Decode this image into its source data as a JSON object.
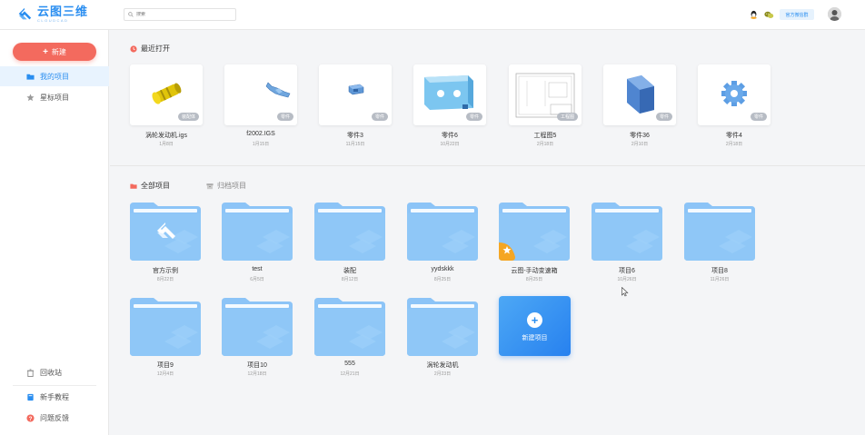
{
  "app": {
    "logo_cn": "云图三维",
    "logo_en": "CLOUDCAD"
  },
  "header": {
    "search_placeholder": "搜索",
    "wechat_label": "官方微信群",
    "icons": [
      "qq-icon",
      "wechat-icon"
    ]
  },
  "sidebar": {
    "new_label": "新建",
    "items": [
      {
        "label": "我的项目",
        "icon": "folder-icon",
        "active": true
      },
      {
        "label": "星标项目",
        "icon": "star-icon",
        "active": false
      }
    ],
    "bottom": [
      {
        "label": "回收站",
        "icon": "trash-icon"
      },
      {
        "label": "新手教程",
        "icon": "book-icon"
      },
      {
        "label": "问题反馈",
        "icon": "question-icon"
      }
    ]
  },
  "recent": {
    "title": "最近打开",
    "items": [
      {
        "name": "涡轮发动机.igs",
        "date": "1月8日",
        "badge": "装配体"
      },
      {
        "name": "f2002.IGS",
        "date": "1月15日",
        "badge": "零件"
      },
      {
        "name": "零件3",
        "date": "11月15日",
        "badge": "零件"
      },
      {
        "name": "零件6",
        "date": "10月22日",
        "badge": "零件"
      },
      {
        "name": "工程图5",
        "date": "2月18日",
        "badge": "工程图"
      },
      {
        "name": "零件36",
        "date": "2月10日",
        "badge": "零件"
      },
      {
        "name": "零件4",
        "date": "2月18日",
        "badge": "零件"
      }
    ]
  },
  "projects": {
    "tabs": [
      {
        "label": "全部项目",
        "active": true
      },
      {
        "label": "归档项目",
        "active": false
      }
    ],
    "folders": [
      {
        "name": "官方示例",
        "date": "8月22日",
        "type": "official"
      },
      {
        "name": "test",
        "date": "6月5日",
        "type": "normal"
      },
      {
        "name": "装配",
        "date": "8月12日",
        "type": "normal"
      },
      {
        "name": "yydskkk",
        "date": "8月25日",
        "type": "normal"
      },
      {
        "name": "云图-手动变速箱",
        "date": "8月25日",
        "type": "starred"
      },
      {
        "name": "项目6",
        "date": "10月26日",
        "type": "normal"
      },
      {
        "name": "项目8",
        "date": "11月26日",
        "type": "normal"
      },
      {
        "name": "项目9",
        "date": "12月4日",
        "type": "normal"
      },
      {
        "name": "项目10",
        "date": "12月18日",
        "type": "normal"
      },
      {
        "name": "555",
        "date": "12月21日",
        "type": "normal"
      },
      {
        "name": "涡轮发动机",
        "date": "2月23日",
        "type": "normal"
      }
    ],
    "new_project_label": "新建项目"
  },
  "colors": {
    "accent": "#2a8ef0",
    "new_button": "#f36a5e",
    "folder": "#8cc4f7",
    "badge": "#b7bcc4"
  }
}
